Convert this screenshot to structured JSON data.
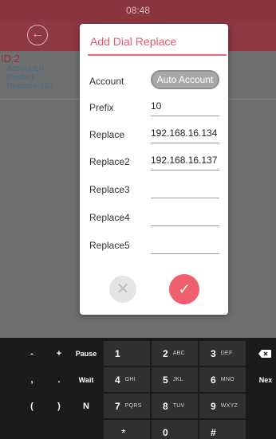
{
  "status": {
    "time": "08:48"
  },
  "header": {
    "back_icon": "arrow-left-circle-icon"
  },
  "entry": {
    "id": "ID:2",
    "account": "Account:0",
    "prefix": "Prefix:1",
    "replace": "Replace:192"
  },
  "dialog": {
    "title": "Add Dial Replace",
    "fields": {
      "account_label": "Account",
      "account_value": "Auto Account",
      "prefix_label": "Prefix",
      "prefix_value": "10",
      "replace_label": "Replace",
      "replace_value": "192.168.16.134",
      "replace2_label": "Replace2",
      "replace2_value": "192.168.16.137",
      "replace3_label": "Replace3",
      "replace3_value": "",
      "replace4_label": "Replace4",
      "replace4_value": "",
      "replace5_label": "Replace5",
      "replace5_value": ""
    },
    "cancel_icon": "close-icon",
    "ok_icon": "check-icon",
    "accent_color": "#F05F6E"
  },
  "keyboard": {
    "row1": [
      "-",
      "+",
      "Pause"
    ],
    "row2": [
      ",",
      ".",
      "Wait"
    ],
    "row3": [
      "(",
      ")",
      "N"
    ],
    "digits": [
      {
        "num": "1",
        "letters": ""
      },
      {
        "num": "2",
        "letters": "ABC"
      },
      {
        "num": "3",
        "letters": "DEF"
      },
      {
        "num": "4",
        "letters": "GHI"
      },
      {
        "num": "5",
        "letters": "JKL"
      },
      {
        "num": "6",
        "letters": "MNO"
      },
      {
        "num": "7",
        "letters": "PQRS"
      },
      {
        "num": "8",
        "letters": "TUV"
      },
      {
        "num": "9",
        "letters": "WXYZ"
      },
      {
        "num": "*",
        "letters": ""
      },
      {
        "num": "0",
        "letters": ""
      },
      {
        "num": "#",
        "letters": ""
      }
    ],
    "backspace_icon": "backspace-icon",
    "next_label": "Nex"
  }
}
